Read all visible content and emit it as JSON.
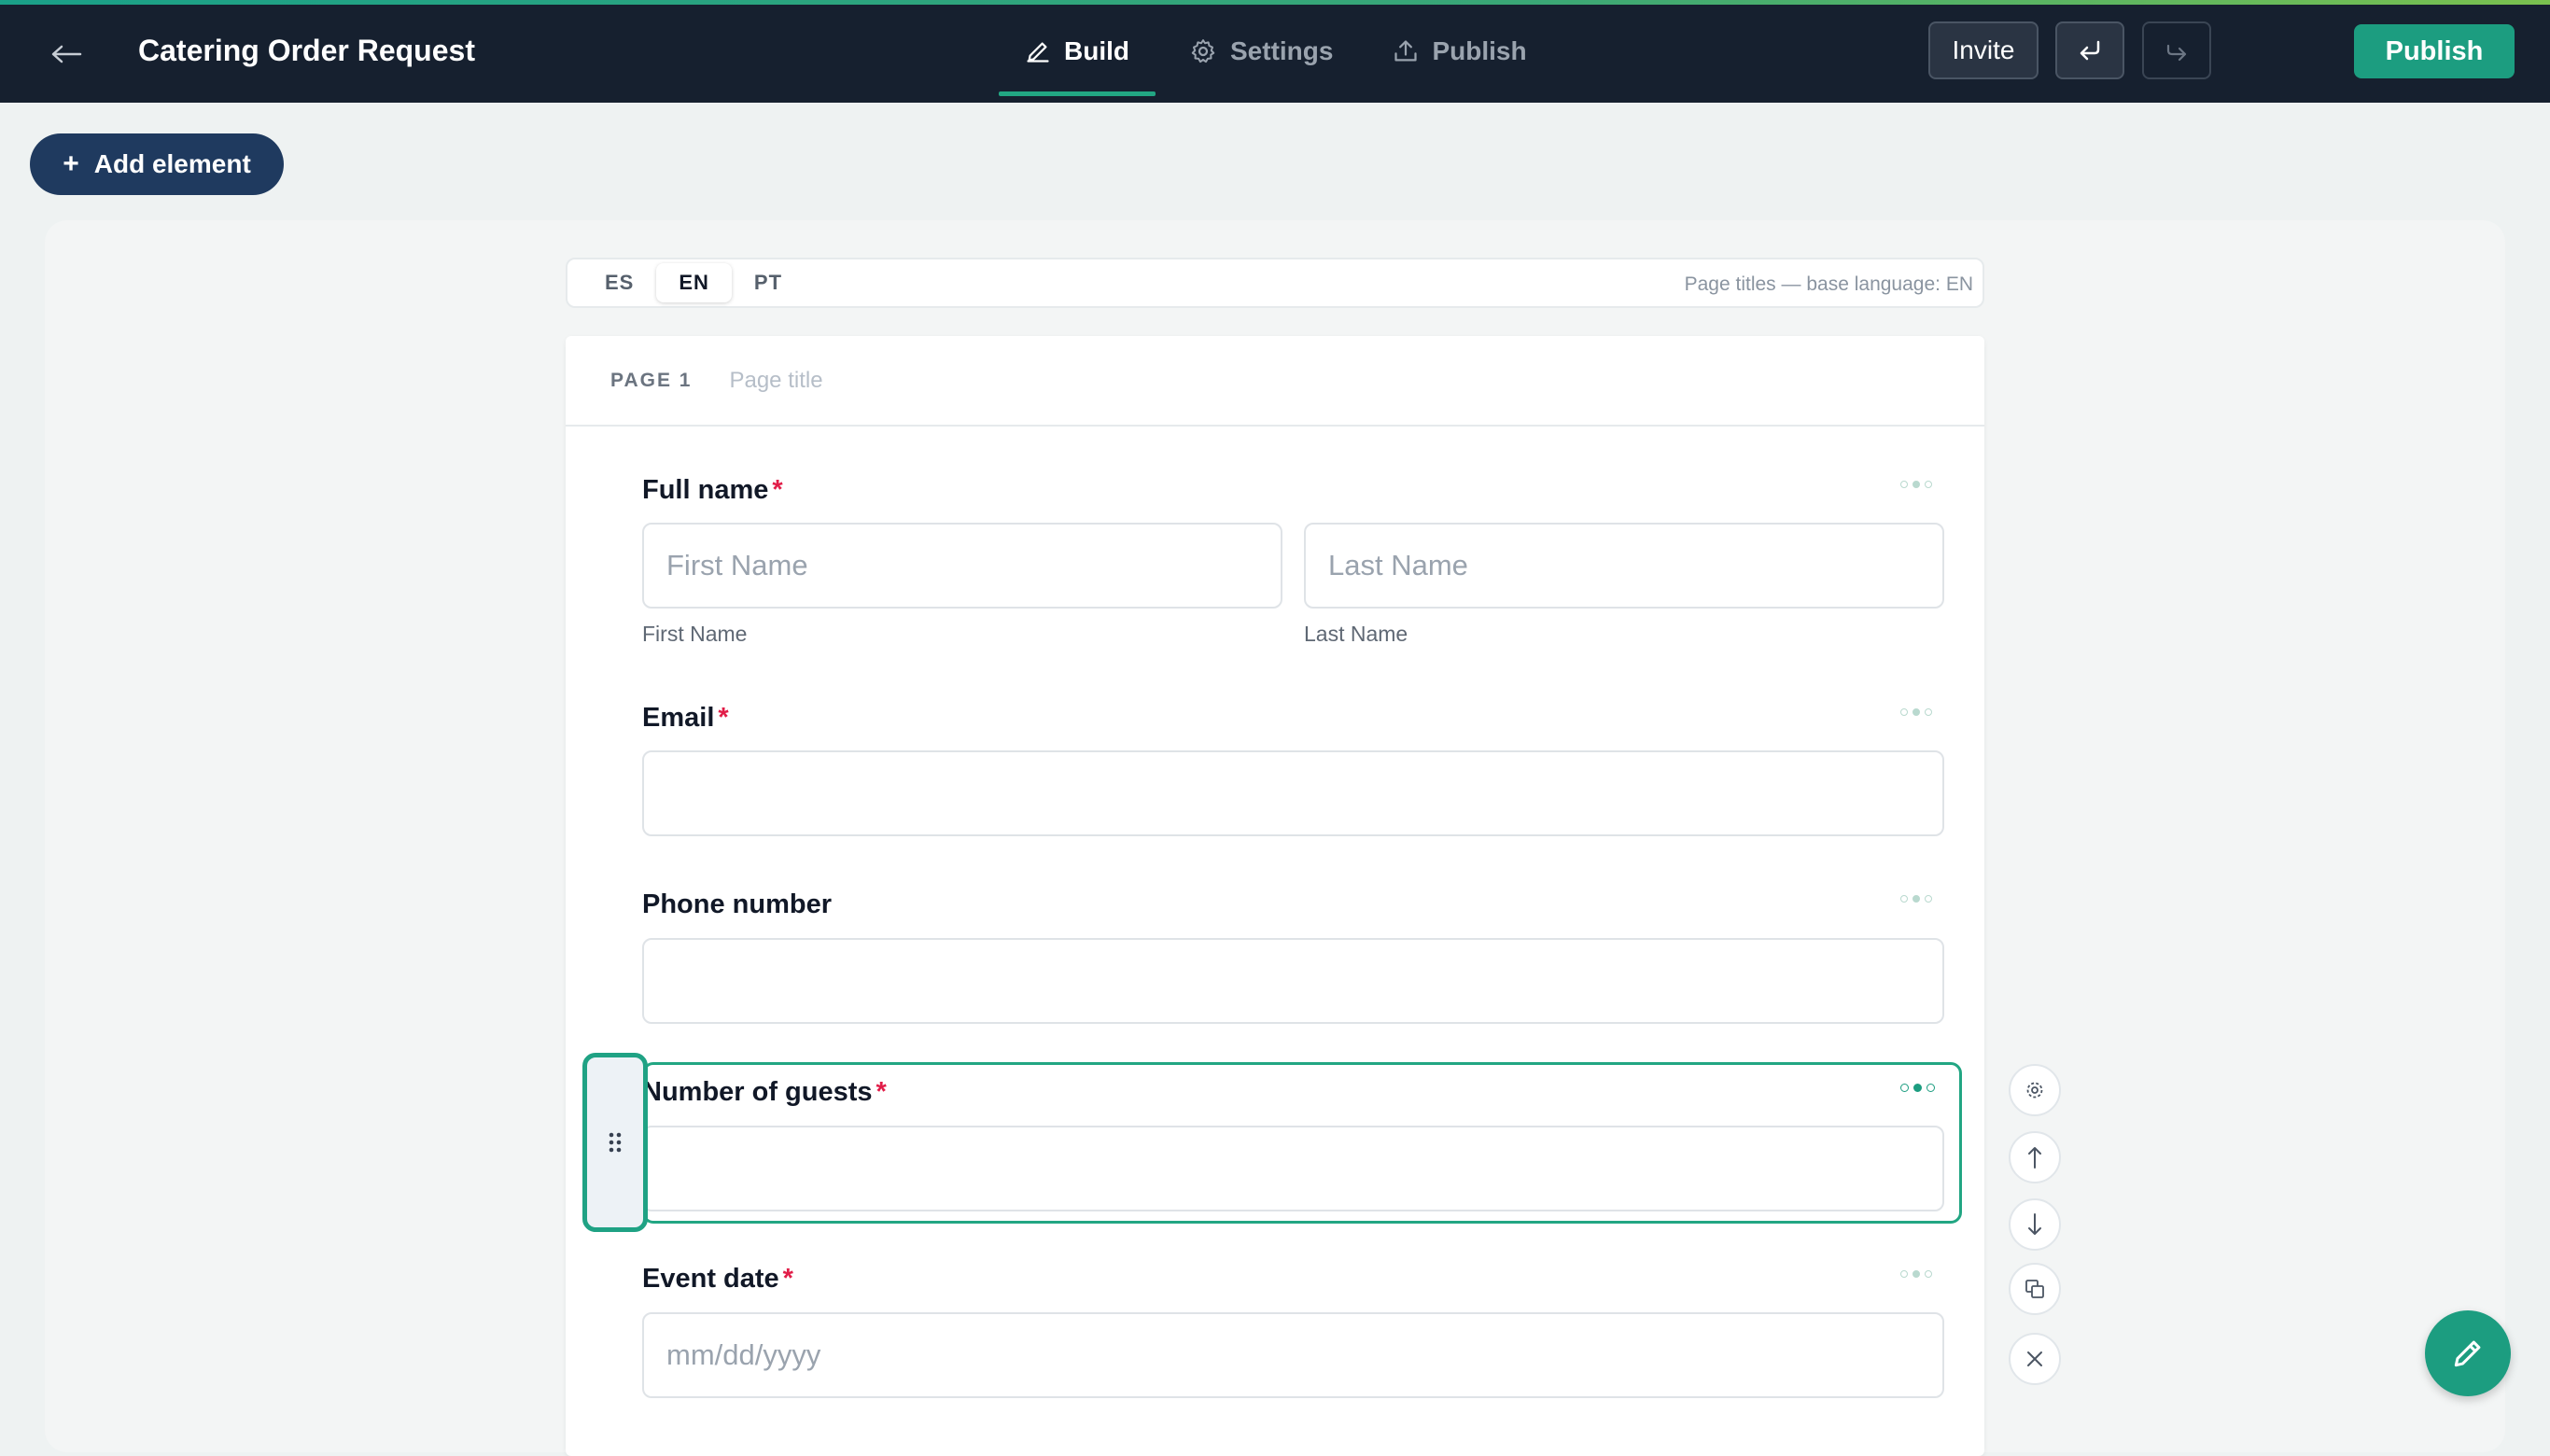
{
  "app": {
    "title": "Catering Order Request"
  },
  "header": {
    "tabs": [
      {
        "label": "Build",
        "icon": "pencil-icon",
        "active": true
      },
      {
        "label": "Settings",
        "icon": "gear-icon",
        "active": false
      },
      {
        "label": "Publish",
        "icon": "upload-icon",
        "active": false
      }
    ],
    "invite_label": "Invite",
    "publish_label": "Publish"
  },
  "toolbar": {
    "add_element_label": "Add element"
  },
  "languages": {
    "items": [
      "ES",
      "EN",
      "PT"
    ],
    "active": "EN",
    "note": "Page titles — base language: EN"
  },
  "page": {
    "label": "PAGE 1",
    "title_placeholder": "Page title"
  },
  "fields": {
    "full_name": {
      "label": "Full name",
      "required": "*",
      "first_placeholder": "First Name",
      "last_placeholder": "Last Name",
      "first_sublabel": "First Name",
      "last_sublabel": "Last Name"
    },
    "email": {
      "label": "Email",
      "required": "*"
    },
    "phone": {
      "label": "Phone number"
    },
    "guests": {
      "label": "Number of guests",
      "required": "*",
      "selected": true
    },
    "event_date": {
      "label": "Event date",
      "required": "*",
      "placeholder": "mm/dd/yyyy"
    }
  },
  "colors": {
    "accent": "#1c9d80",
    "topbar": "#16202f",
    "add_element": "#1f3a5f",
    "required": "#e11d48"
  }
}
